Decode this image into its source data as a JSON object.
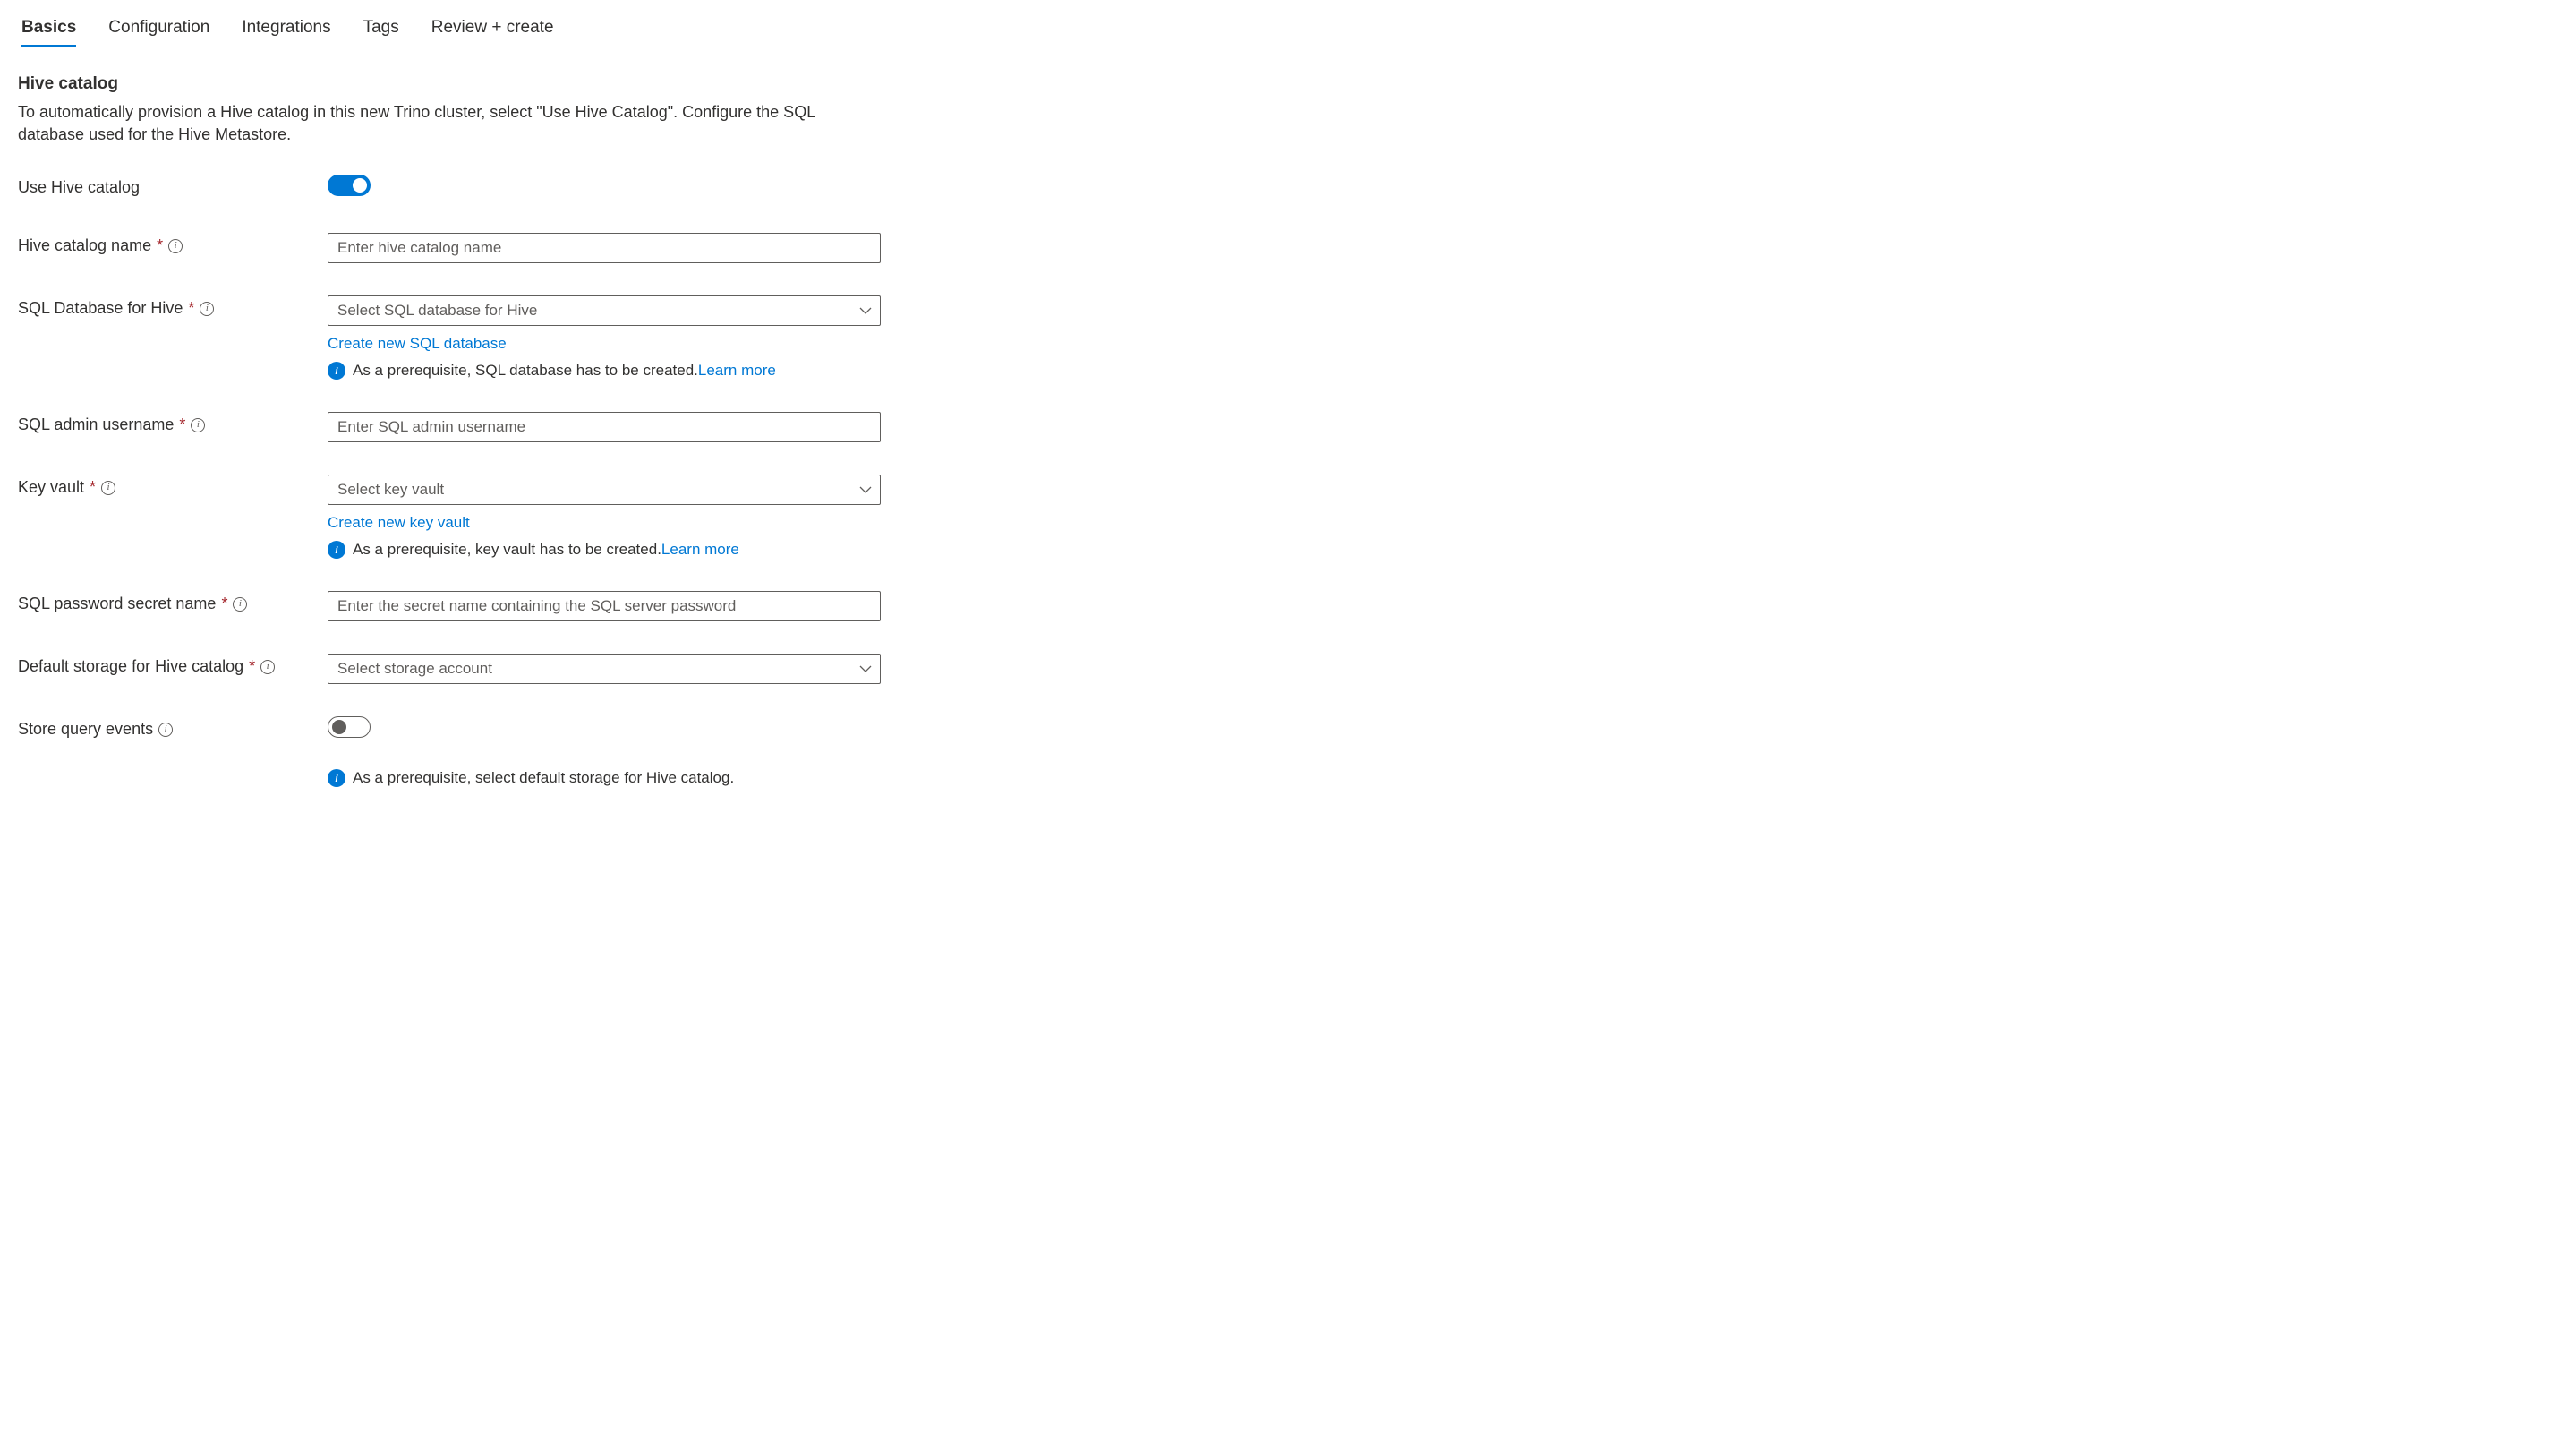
{
  "tabs": {
    "basics": "Basics",
    "configuration": "Configuration",
    "integrations": "Integrations",
    "tags": "Tags",
    "review": "Review + create"
  },
  "section": {
    "title": "Hive catalog",
    "description": "To automatically provision a Hive catalog in this new Trino cluster, select \"Use Hive Catalog\". Configure the SQL database used for the Hive Metastore."
  },
  "fields": {
    "use_hive": {
      "label": "Use Hive catalog"
    },
    "catalog_name": {
      "label": "Hive catalog name",
      "placeholder": "Enter hive catalog name"
    },
    "sql_db": {
      "label": "SQL Database for Hive",
      "placeholder": "Select SQL database for Hive",
      "create_link": "Create new SQL database",
      "info_text": "As a prerequisite, SQL database has to be created.",
      "learn": "Learn more"
    },
    "sql_user": {
      "label": "SQL admin username",
      "placeholder": "Enter SQL admin username"
    },
    "key_vault": {
      "label": "Key vault",
      "placeholder": "Select key vault",
      "create_link": "Create new key vault",
      "info_text": "As a prerequisite, key vault has to be created.",
      "learn": "Learn more"
    },
    "secret_name": {
      "label": "SQL password secret name",
      "placeholder": "Enter the secret name containing the SQL server password"
    },
    "default_storage": {
      "label": "Default storage for Hive catalog",
      "placeholder": "Select storage account"
    },
    "store_query": {
      "label": "Store query events",
      "info_text": "As a prerequisite, select default storage for Hive catalog."
    }
  }
}
